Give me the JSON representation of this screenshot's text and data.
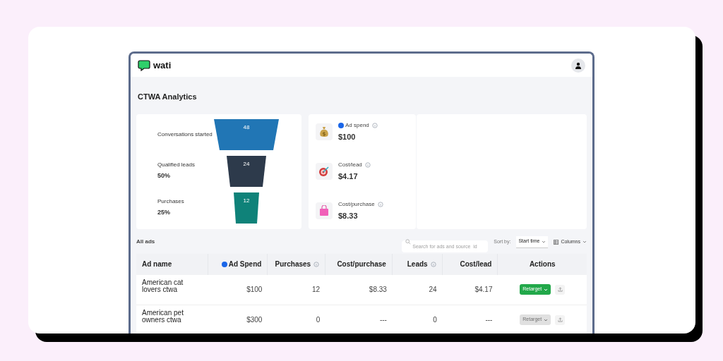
{
  "app": {
    "logo_text": "wati"
  },
  "page": {
    "title": "CTWA Analytics"
  },
  "funnel": [
    {
      "label": "Conversations started",
      "value": "48",
      "color": "#2176b5"
    },
    {
      "label": "Qualified leads",
      "percent": "50%",
      "value": "24",
      "color": "#2d3a4b"
    },
    {
      "label": "Purchases",
      "percent": "25%",
      "value": "12",
      "color": "#0f8279"
    }
  ],
  "metrics": [
    {
      "kind": "spend",
      "label": "Ad spend",
      "value": "$100",
      "color": "#1a66e8"
    },
    {
      "kind": "target",
      "label": "Cost/lead",
      "value": "$4.17"
    },
    {
      "kind": "bag",
      "label": "Cost/purchase",
      "value": "$8.33"
    }
  ],
  "ads": {
    "title": "All ads",
    "search_placeholder": "Search for ads and source_id",
    "sort_label": "Sort by:",
    "sort_value": "Start time",
    "columns_button": "Columns"
  },
  "table": {
    "columns": [
      {
        "label": "Ad name",
        "info": false,
        "dot": false
      },
      {
        "label": "Ad Spend",
        "info": false,
        "dot": true
      },
      {
        "label": "Purchases",
        "info": true,
        "dot": false
      },
      {
        "label": "Cost/purchase",
        "info": false,
        "dot": false
      },
      {
        "label": "Leads",
        "info": true,
        "dot": false
      },
      {
        "label": "Cost/lead",
        "info": false,
        "dot": false
      },
      {
        "label": "Actions",
        "info": false,
        "dot": false
      }
    ],
    "rows": [
      {
        "cells": [
          "American cat lovers ctwa",
          "$100",
          "12",
          "$8.33",
          "24",
          "$4.17"
        ],
        "action": "Retarget",
        "disabled": false
      },
      {
        "cells": [
          "American pet owners ctwa",
          "$300",
          "0",
          "---",
          "0",
          "---"
        ],
        "action": "Retarget",
        "disabled": true
      }
    ]
  }
}
